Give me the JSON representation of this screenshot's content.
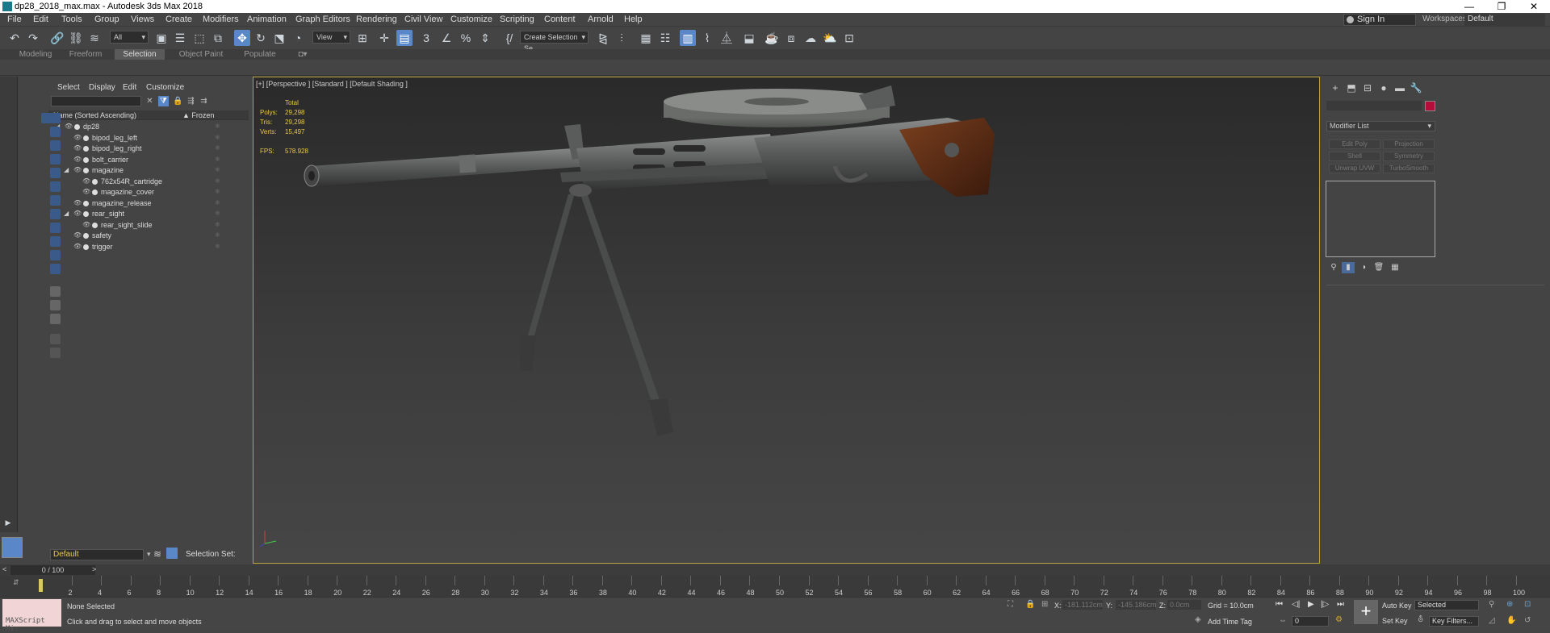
{
  "window": {
    "title": "dp28_2018_max.max - Autodesk 3ds Max 2018",
    "controls": [
      "—",
      "❐",
      "✕"
    ]
  },
  "menu": [
    "File",
    "Edit",
    "Tools",
    "Group",
    "Views",
    "Create",
    "Modifiers",
    "Animation",
    "Graph Editors",
    "Rendering",
    "Civil View",
    "Customize",
    "Scripting",
    "Content",
    "Arnold",
    "Help"
  ],
  "account": {
    "signin": "Sign In",
    "workspaces_label": "Workspaces:",
    "workspace": "Default"
  },
  "toolbar": {
    "filter": "All",
    "refcoord": "View",
    "selection_set": "Create Selection Se"
  },
  "ribbon_tabs": [
    "Modeling",
    "Freeform",
    "Selection",
    "Object Paint",
    "Populate"
  ],
  "scene_explorer": {
    "tabs": [
      "Select",
      "Display",
      "Edit",
      "Customize"
    ],
    "col_name": "Name (Sorted Ascending)",
    "col_frozen": "▲ Frozen",
    "rows": [
      {
        "name": "dp28",
        "level": 0,
        "expand": true
      },
      {
        "name": "bipod_leg_left",
        "level": 1,
        "expand": false
      },
      {
        "name": "bipod_leg_right",
        "level": 1,
        "expand": false
      },
      {
        "name": "bolt_carrier",
        "level": 1,
        "expand": false
      },
      {
        "name": "magazine",
        "level": 1,
        "expand": true
      },
      {
        "name": "762x54R_cartridge",
        "level": 2,
        "expand": false
      },
      {
        "name": "magazine_cover",
        "level": 2,
        "expand": false
      },
      {
        "name": "magazine_release",
        "level": 1,
        "expand": false
      },
      {
        "name": "rear_sight",
        "level": 1,
        "expand": true
      },
      {
        "name": "rear_sight_slide",
        "level": 2,
        "expand": false
      },
      {
        "name": "safety",
        "level": 1,
        "expand": false
      },
      {
        "name": "trigger",
        "level": 1,
        "expand": false
      }
    ],
    "layer": "Default",
    "selection_set": "Selection Set:"
  },
  "viewport": {
    "label": "[+] [Perspective ] [Standard ] [Default Shading ]",
    "stats": {
      "header": "Total",
      "polys_label": "Polys:",
      "polys": "29,298",
      "tris_label": "Tris:",
      "tris": "29,298",
      "verts_label": "Verts:",
      "verts": "15,497",
      "fps_label": "FPS:",
      "fps": "578.928"
    }
  },
  "command_panel": {
    "modifier_list": "Modifier List",
    "buttons": [
      "Edit Poly",
      "Projection",
      "Shell",
      "Symmetry",
      "Unwrap UVW",
      "TurboSmooth"
    ],
    "object_color": "#b30e3a"
  },
  "timeline": {
    "frame_display": "0 / 100",
    "ticks": [
      "2",
      "4",
      "6",
      "8",
      "10",
      "12",
      "14",
      "16",
      "18",
      "20",
      "22",
      "24",
      "26",
      "28",
      "30",
      "32",
      "34",
      "36",
      "38",
      "40",
      "42",
      "44",
      "46",
      "48",
      "50",
      "52",
      "54",
      "56",
      "58",
      "60",
      "62",
      "64",
      "66",
      "68",
      "70",
      "72",
      "74",
      "76",
      "78",
      "80",
      "82",
      "84",
      "86",
      "88",
      "90",
      "92",
      "94",
      "96",
      "98",
      "100"
    ]
  },
  "status": {
    "maxscript": "MAXScript Mi:",
    "selection": "None Selected",
    "prompt": "Click and drag to select and move objects",
    "x_label": "X:",
    "x": "-181.112cm",
    "y_label": "Y:",
    "y": "-145.186cm",
    "z_label": "Z:",
    "z": "0.0cm",
    "grid": "Grid = 10.0cm",
    "add_time_tag": "Add Time Tag",
    "auto_key": "Auto Key",
    "set_key": "Set Key",
    "key_mode": "Selected",
    "key_filters": "Key Filters...",
    "frame": "0"
  }
}
